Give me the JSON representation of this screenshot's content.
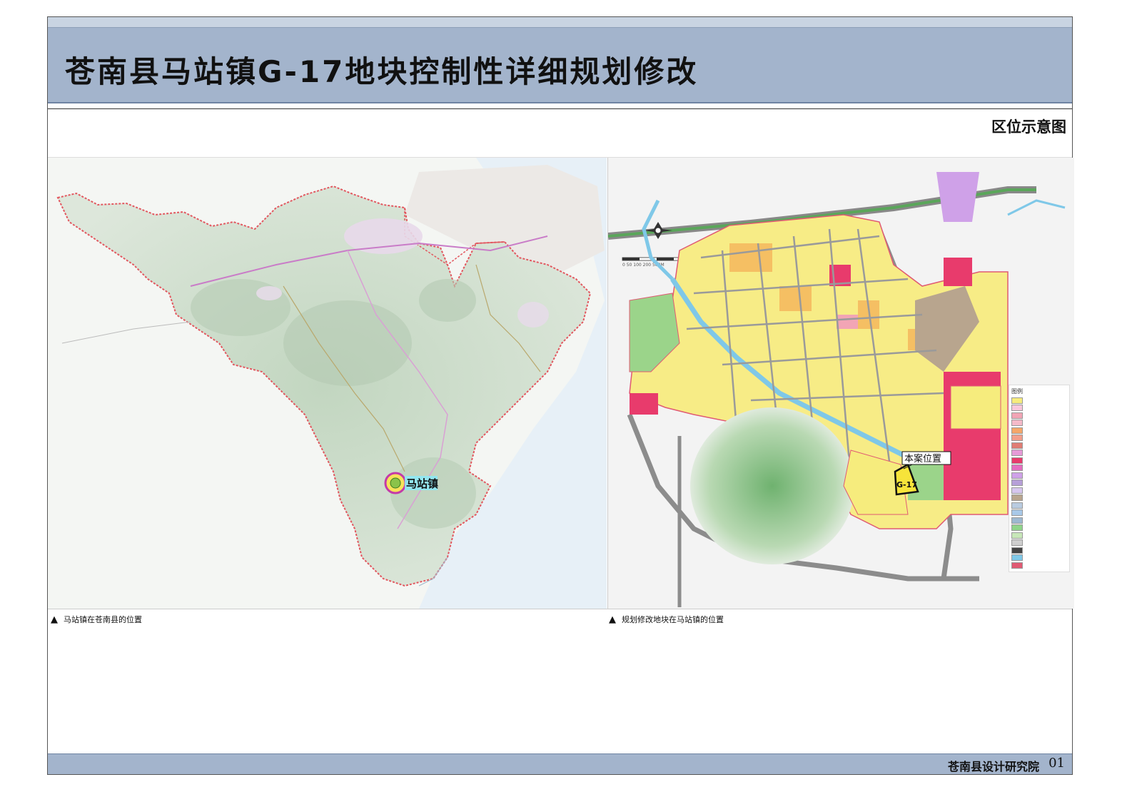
{
  "header": {
    "title": "苍南县马站镇G-17地块控制性详细规划修改",
    "subtitle": "区位示意图"
  },
  "left_map": {
    "town_label": "马站镇",
    "caption": "马站镇在苍南县的位置"
  },
  "right_map": {
    "site_label": "本案位置",
    "parcel_label": "G-17",
    "scale_label": "0  50  100  200        500M",
    "legend_title": "图例",
    "legend_colors": [
      "#f6ec7d",
      "#f8c7dc",
      "#f2a5b5",
      "#f4b9c9",
      "#f5a76a",
      "#f29f8c",
      "#e07d74",
      "#e69ad8",
      "#e83b6c",
      "#e46ec0",
      "#cfa1e8",
      "#b69fd8",
      "#d6c6ee",
      "#b8a58e",
      "#b9cbe0",
      "#a8c8e8",
      "#9db8d0",
      "#8fd48a",
      "#c7e7b8",
      "#cfcfcf",
      "#444444",
      "#7fc8e8",
      "#e05a73"
    ],
    "caption": "规划修改地块在马站镇的位置"
  },
  "footer": {
    "org": "苍南县设计研究院",
    "page": "01"
  }
}
